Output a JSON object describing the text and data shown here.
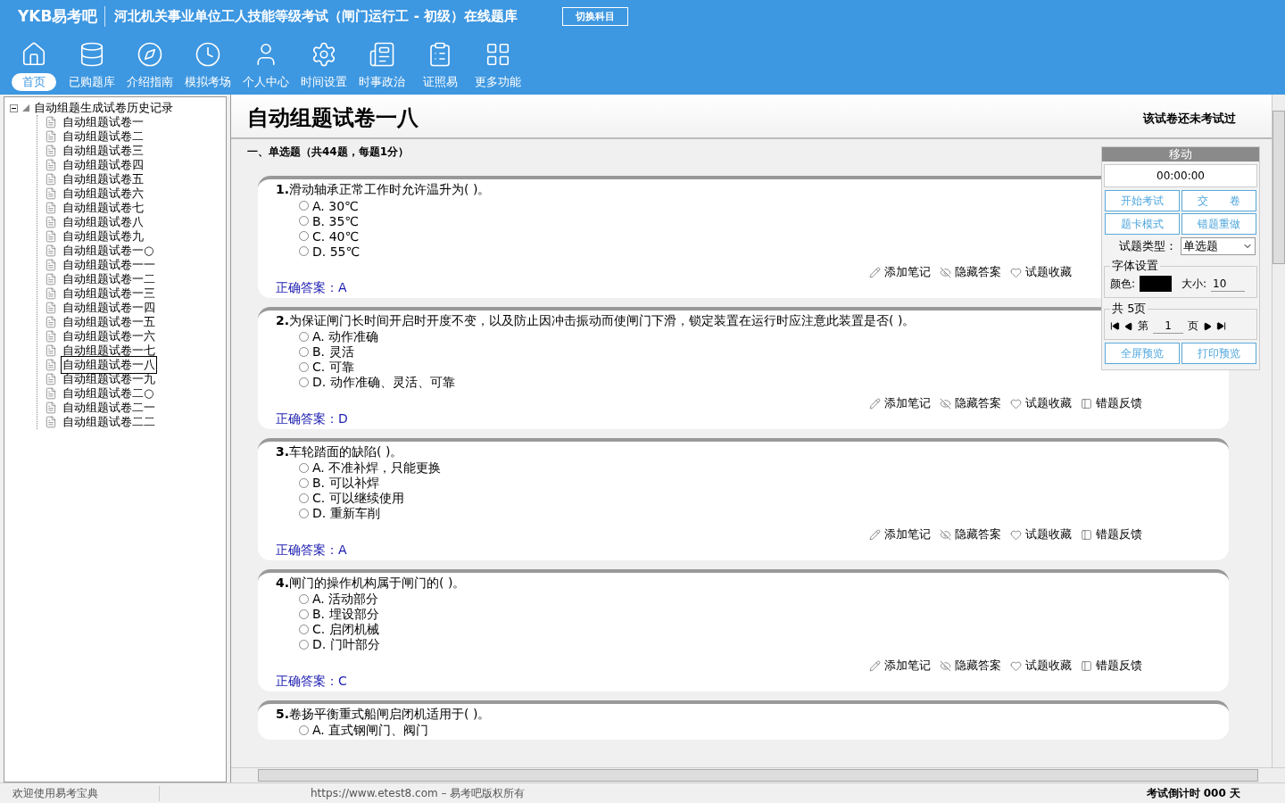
{
  "header": {
    "logo": "YKB易考吧",
    "title": "河北机关事业单位工人技能等级考试（闸门运行工 - 初级）在线题库",
    "switch_button": "切换科目",
    "nav": [
      {
        "label": "首页",
        "selected": true
      },
      {
        "label": "已购题库",
        "selected": false
      },
      {
        "label": "介绍指南",
        "selected": false
      },
      {
        "label": "模拟考场",
        "selected": false
      },
      {
        "label": "个人中心",
        "selected": false
      },
      {
        "label": "时间设置",
        "selected": false
      },
      {
        "label": "时事政治",
        "selected": false
      },
      {
        "label": "证照易",
        "selected": false
      },
      {
        "label": "更多功能",
        "selected": false
      }
    ]
  },
  "tree": {
    "label": "自动组题生成试卷历史记录",
    "expanded": true,
    "children": [
      {
        "label": "自动组题试卷一",
        "selected": false
      },
      {
        "label": "自动组题试卷二",
        "selected": false
      },
      {
        "label": "自动组题试卷三",
        "selected": false
      },
      {
        "label": "自动组题试卷四",
        "selected": false
      },
      {
        "label": "自动组题试卷五",
        "selected": false
      },
      {
        "label": "自动组题试卷六",
        "selected": false
      },
      {
        "label": "自动组题试卷七",
        "selected": false
      },
      {
        "label": "自动组题试卷八",
        "selected": false
      },
      {
        "label": "自动组题试卷九",
        "selected": false
      },
      {
        "label": "自动组题试卷一○",
        "selected": false
      },
      {
        "label": "自动组题试卷一一",
        "selected": false
      },
      {
        "label": "自动组题试卷一二",
        "selected": false
      },
      {
        "label": "自动组题试卷一三",
        "selected": false
      },
      {
        "label": "自动组题试卷一四",
        "selected": false
      },
      {
        "label": "自动组题试卷一五",
        "selected": false
      },
      {
        "label": "自动组题试卷一六",
        "selected": false
      },
      {
        "label": "自动组题试卷一七",
        "selected": false
      },
      {
        "label": "自动组题试卷一八",
        "selected": true
      },
      {
        "label": "自动组题试卷一九",
        "selected": false
      },
      {
        "label": "自动组题试卷二○",
        "selected": false
      },
      {
        "label": "自动组题试卷二一",
        "selected": false
      },
      {
        "label": "自动组题试卷二二",
        "selected": false
      }
    ]
  },
  "paper": {
    "title": "自动组题试卷一八",
    "status": "该试卷还未考试过",
    "section": "一、单选题（共44题，每题1分）",
    "questions": [
      {
        "number": "1.",
        "text": "滑动轴承正常工作时允许温升为( )。",
        "options": [
          {
            "label": "A.",
            "text": "30℃",
            "selected": false
          },
          {
            "label": "B.",
            "text": "35℃",
            "selected": false
          },
          {
            "label": "C.",
            "text": "40℃",
            "selected": false
          },
          {
            "label": "D.",
            "text": "55℃",
            "selected": false
          }
        ],
        "answer_label": "正确答案：",
        "answer": "A",
        "tools": [
          "添加笔记",
          "隐藏答案",
          "试题收藏"
        ]
      },
      {
        "number": "2.",
        "text": "为保证闸门长时间开启时开度不变，以及防止因冲击振动而使闸门下滑，锁定装置在运行时应注意此装置是否( )。",
        "options": [
          {
            "label": "A.",
            "text": "动作准确",
            "selected": false
          },
          {
            "label": "B.",
            "text": "灵活",
            "selected": false
          },
          {
            "label": "C.",
            "text": "可靠",
            "selected": false
          },
          {
            "label": "D.",
            "text": "动作准确、灵活、可靠",
            "selected": false
          }
        ],
        "answer_label": "正确答案：",
        "answer": "D",
        "tools": [
          "添加笔记",
          "隐藏答案",
          "试题收藏",
          "错题反馈"
        ]
      },
      {
        "number": "3.",
        "text": "车轮踏面的缺陷( )。",
        "options": [
          {
            "label": "A.",
            "text": "不准补焊，只能更换",
            "selected": false
          },
          {
            "label": "B.",
            "text": "可以补焊",
            "selected": false
          },
          {
            "label": "C.",
            "text": "可以继续使用",
            "selected": false
          },
          {
            "label": "D.",
            "text": "重新车削",
            "selected": false
          }
        ],
        "answer_label": "正确答案：",
        "answer": "A",
        "tools": [
          "添加笔记",
          "隐藏答案",
          "试题收藏",
          "错题反馈"
        ]
      },
      {
        "number": "4.",
        "text": "闸门的操作机构属于闸门的( )。",
        "options": [
          {
            "label": "A.",
            "text": "活动部分",
            "selected": false
          },
          {
            "label": "B.",
            "text": "埋设部分",
            "selected": false
          },
          {
            "label": "C.",
            "text": "启闭机械",
            "selected": false
          },
          {
            "label": "D.",
            "text": "门叶部分",
            "selected": false
          }
        ],
        "answer_label": "正确答案：",
        "answer": "C",
        "tools": [
          "添加笔记",
          "隐藏答案",
          "试题收藏",
          "错题反馈"
        ]
      },
      {
        "number": "5.",
        "text": "卷扬平衡重式船闸启闭机适用于( )。",
        "options": [
          {
            "label": "A.",
            "text": "直式钢闸门、阀门",
            "selected": false
          }
        ]
      }
    ]
  },
  "panel": {
    "move": "移动",
    "timer": "00:00:00",
    "buttons": [
      "开始考试",
      "交　　卷",
      "题卡模式",
      "错题重做"
    ],
    "type_label": "试题类型：",
    "type_value": "单选题",
    "font_legend": "字体设置",
    "color_label": "颜色:",
    "color": "#000000",
    "size_label": "大小:",
    "size": "10",
    "pages_legend": "共 5页",
    "page_prefix": "第",
    "page": "1",
    "page_suffix": "页",
    "preview_buttons": [
      "全屏预览",
      "打印预览"
    ]
  },
  "status": {
    "left": "欢迎使用易考宝典",
    "center": "https://www.etest8.com – 易考吧版权所有",
    "right": "考试倒计时 000 天"
  }
}
